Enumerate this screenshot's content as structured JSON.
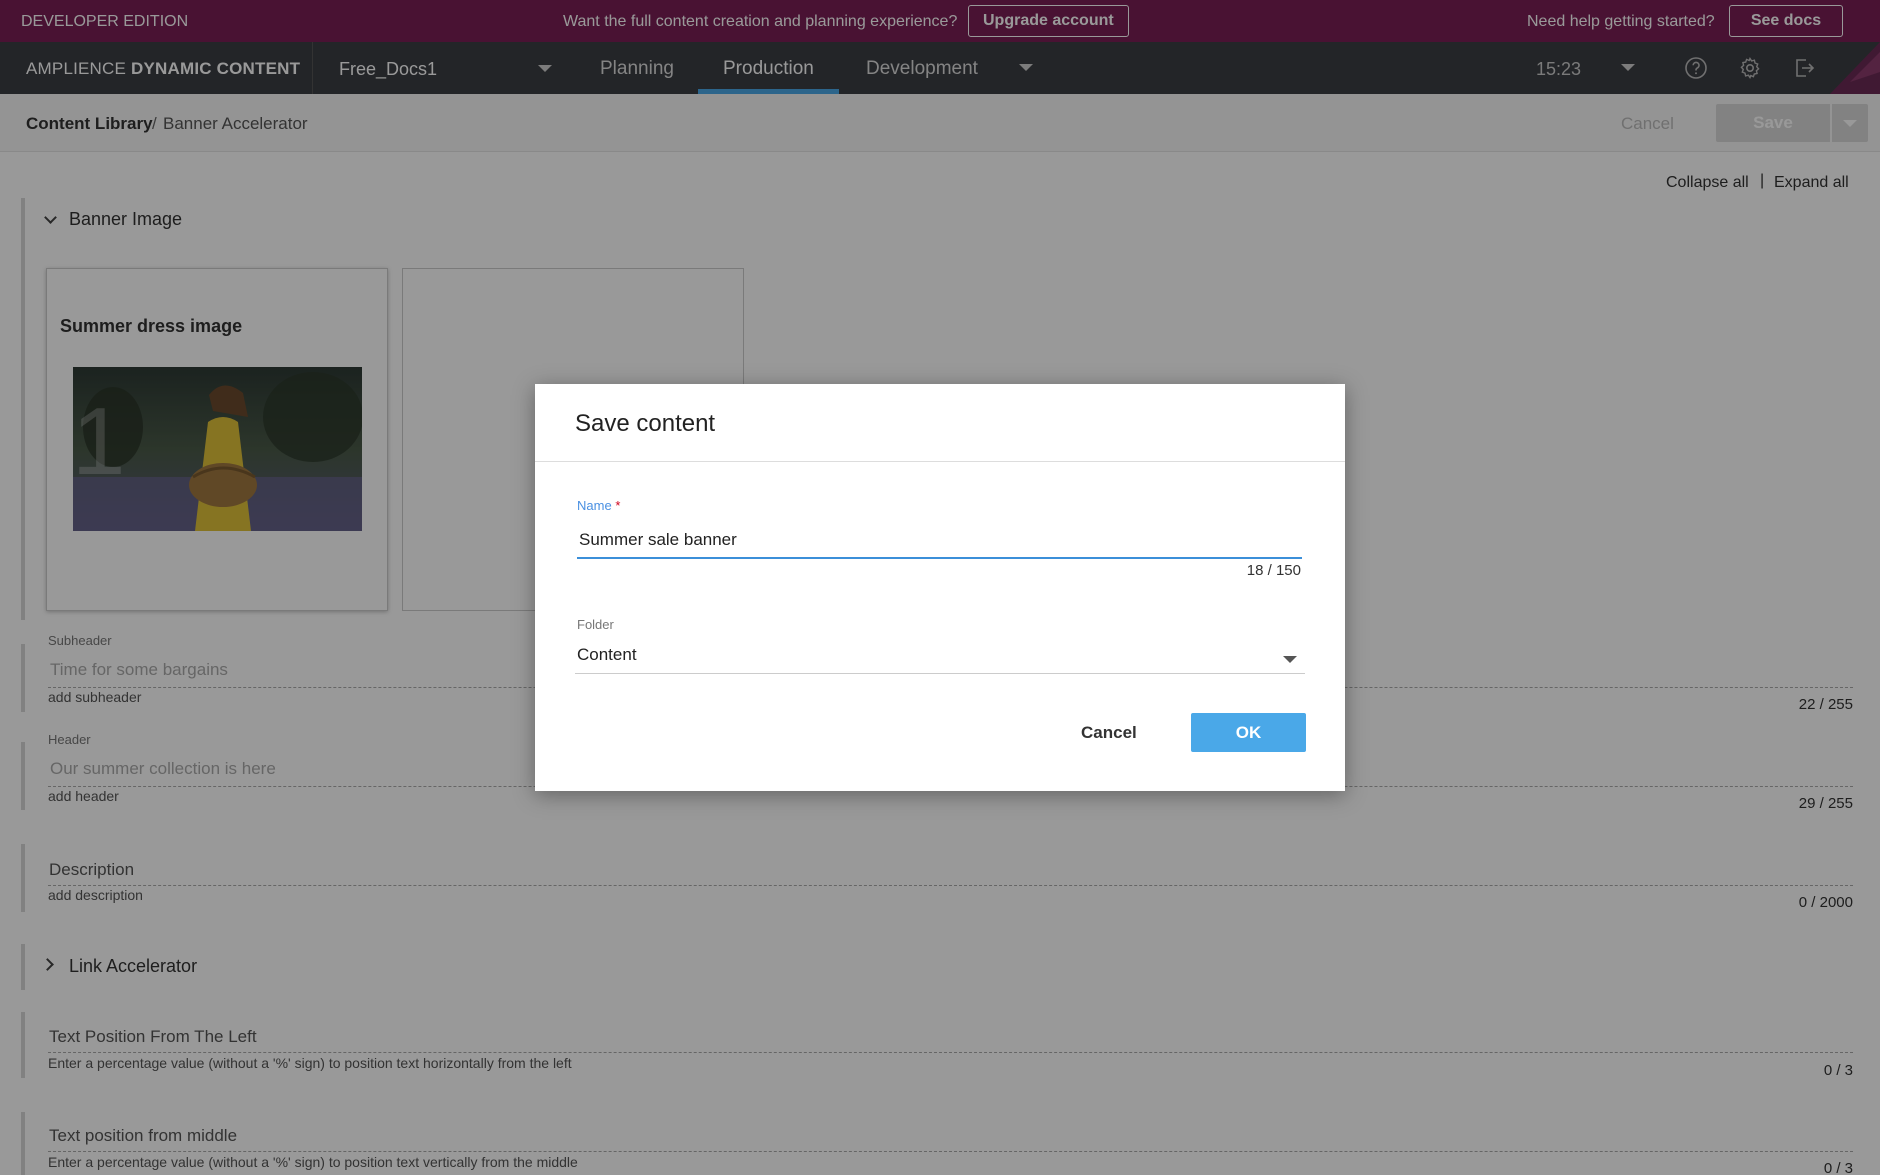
{
  "promo": {
    "edition": "DEVELOPER EDITION",
    "message": "Want the full content creation and planning experience?",
    "upgrade_label": "Upgrade account",
    "help_text": "Need help getting started?",
    "docs_label": "See docs"
  },
  "nav": {
    "brand_light": "AMPLIENCE ",
    "brand_bold": "DYNAMIC CONTENT",
    "hub": "Free_Docs1",
    "tabs": [
      {
        "label": "Planning"
      },
      {
        "label": "Production"
      },
      {
        "label": "Development"
      }
    ],
    "active_tab": "Production",
    "time": "15:23",
    "accent_color": "#4aa8e8",
    "promo_color": "#7b1f55",
    "icons": [
      "help-icon",
      "gear-icon",
      "logout-icon"
    ]
  },
  "breadcrumb": {
    "root": "Content Library",
    "separator": "/",
    "current": "Banner Accelerator",
    "cancel_label": "Cancel",
    "save_label": "Save"
  },
  "editor": {
    "collapse_all": "Collapse all",
    "separator": "|",
    "expand_all": "Expand all",
    "banner_section": "Banner Image",
    "card_title": "Summer dress image",
    "card_number": "1",
    "fields": [
      {
        "label": "Subheader",
        "value": "Time for some bargains",
        "help": "add subheader",
        "count": "22 / 255"
      },
      {
        "label": "Header",
        "value": "Our summer collection is here",
        "help": "add header",
        "count": "29 / 255"
      },
      {
        "placeholder": "Description",
        "help": "add description",
        "count": "0 / 2000"
      }
    ],
    "link_section": "Link Accelerator",
    "position_fields": [
      {
        "placeholder": "Text Position From The Left",
        "help": "Enter a percentage value (without a '%' sign) to position text horizontally from the left",
        "count": "0 / 3"
      },
      {
        "placeholder": "Text position from middle",
        "help": "Enter a percentage value (without a '%' sign) to position text vertically from the middle",
        "count": "0 / 3"
      }
    ]
  },
  "dialog": {
    "title": "Save content",
    "name_label": "Name",
    "required_mark": "*",
    "name_value": "Summer sale banner",
    "name_count": "18 / 150",
    "folder_label": "Folder",
    "folder_value": "Content",
    "cancel_label": "Cancel",
    "ok_label": "OK"
  }
}
